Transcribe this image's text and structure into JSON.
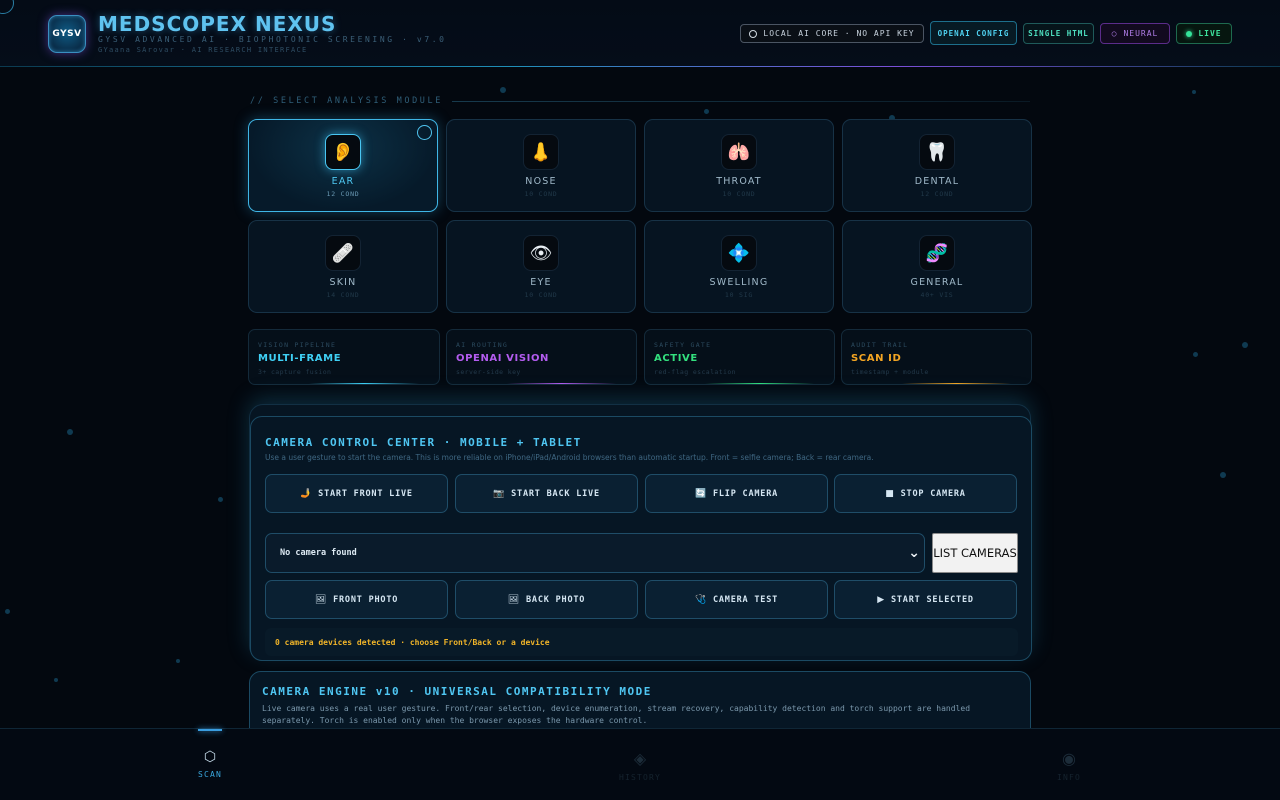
{
  "header": {
    "logo_text": "GYSV",
    "title": "MEDSCOPEX NEXUS",
    "subtitle": "GYSV ADVANCED AI · BIOPHOTONIC SCREENING · v7.0",
    "subtitle2": "GYaana SArovar · AI RESEARCH INTERFACE",
    "badges": {
      "local": "LOCAL AI CORE · NO API KEY",
      "openai": "OPENAI CONFIG",
      "single": "SINGLE HTML",
      "neural": "NEURAL",
      "live": "LIVE"
    }
  },
  "section_label": "//  SELECT ANALYSIS MODULE",
  "modules": [
    {
      "name": "EAR",
      "count": "12 COND",
      "icon": "👂"
    },
    {
      "name": "NOSE",
      "count": "10 COND",
      "icon": "👃"
    },
    {
      "name": "THROAT",
      "count": "10 COND",
      "icon": "🫁"
    },
    {
      "name": "DENTAL",
      "count": "12 COND",
      "icon": "🦷"
    },
    {
      "name": "SKIN",
      "count": "14 COND",
      "icon": "🩹"
    },
    {
      "name": "EYE",
      "count": "10 COND",
      "icon": "👁"
    },
    {
      "name": "SWELLING",
      "count": "10 SIG",
      "icon": "💠"
    },
    {
      "name": "GENERAL",
      "count": "40+ VIS",
      "icon": "🧬"
    }
  ],
  "stats": [
    {
      "label": "VISION PIPELINE",
      "value": "MULTI-FRAME",
      "desc": "3+ capture fusion",
      "color": "#3fd0f5"
    },
    {
      "label": "AI ROUTING",
      "value": "OPENAI VISION",
      "desc": "server-side key",
      "color": "#b45cf0"
    },
    {
      "label": "SAFETY GATE",
      "value": "ACTIVE",
      "desc": "red-flag escalation",
      "color": "#33e07e"
    },
    {
      "label": "AUDIT TRAIL",
      "value": "SCAN ID",
      "desc": "timestamp + module",
      "color": "#f5a623"
    }
  ],
  "camera": {
    "title": "CAMERA CONTROL CENTER · MOBILE + TABLET",
    "desc": "Use a user gesture to start the camera. This is more reliable on iPhone/iPad/Android browsers than automatic startup. Front = selfie camera; Back = rear camera.",
    "buttons_row1": [
      {
        "icon": "🤳",
        "label": "START FRONT LIVE"
      },
      {
        "icon": "📷",
        "label": "START BACK LIVE"
      },
      {
        "icon": "🔄",
        "label": "FLIP CAMERA"
      },
      {
        "icon": "■",
        "label": "STOP CAMERA"
      }
    ],
    "select_value": "No camera found",
    "list_button": "LIST CAMERAS",
    "buttons_row2": [
      {
        "icon": "🖼",
        "label": "FRONT PHOTO"
      },
      {
        "icon": "🖼",
        "label": "BACK PHOTO"
      },
      {
        "icon": "🩺",
        "label": "CAMERA TEST"
      },
      {
        "icon": "▶",
        "label": "START SELECTED"
      }
    ],
    "status": "0 camera devices detected · choose Front/Back or a device"
  },
  "engine": {
    "title": "CAMERA ENGINE v10 · UNIVERSAL COMPATIBILITY MODE",
    "desc": "Live camera uses a real user gesture. Front/rear selection, device enumeration, stream recovery, capability detection and torch support are handled separately. Torch is enabled only when the browser exposes the hardware control."
  },
  "nav": [
    {
      "label": "SCAN",
      "icon": "⬡"
    },
    {
      "label": "HISTORY",
      "icon": "◈"
    },
    {
      "label": "INFO",
      "icon": "◉"
    }
  ]
}
